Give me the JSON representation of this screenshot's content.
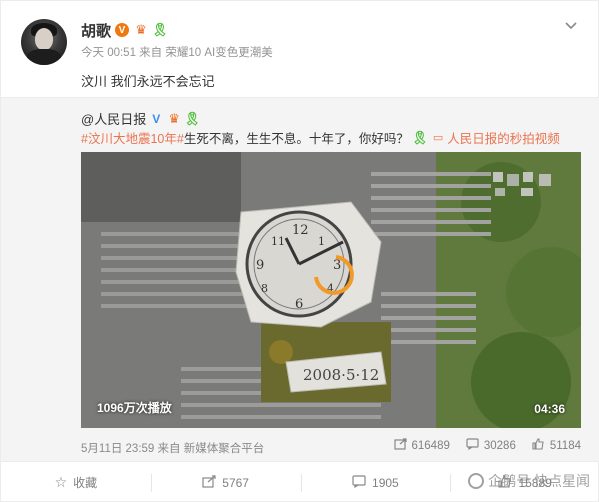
{
  "post": {
    "author": "胡歌",
    "meta": "今天 00:51 来自 荣耀10 AI变色更潮美",
    "text": "汶川 我们永远不会忘记"
  },
  "repost": {
    "author": "@人民日报",
    "hashtag": "#汶川大地震10年#",
    "text": " 生死不离，生生不息。十年了，你好吗？",
    "video_link": "人民日报的秒拍视频",
    "video": {
      "views": "1096万次播放",
      "duration": "04:36",
      "stone_date": "2008·5·12"
    },
    "time": "5月11日 23:59 来自 新媒体聚合平台",
    "stats": {
      "reposts": "616489",
      "comments": "30286",
      "likes": "51184"
    }
  },
  "actions": {
    "favorite": "收藏",
    "repost": "5767",
    "comment": "1905",
    "like": "15889"
  },
  "watermark": "企鹅号 快点星闻",
  "icons": {
    "verified": "verified-orange-icon",
    "crown": "vip-crown-icon",
    "ribbon": "green-ribbon-icon",
    "verified_blue": "verified-blue-icon"
  },
  "colors": {
    "accent": "#eb7350",
    "link": "#eb7350",
    "verified_orange": "#f0790f",
    "verified_blue": "#3d8ee9",
    "ribbon_green": "#4fbf3b"
  }
}
